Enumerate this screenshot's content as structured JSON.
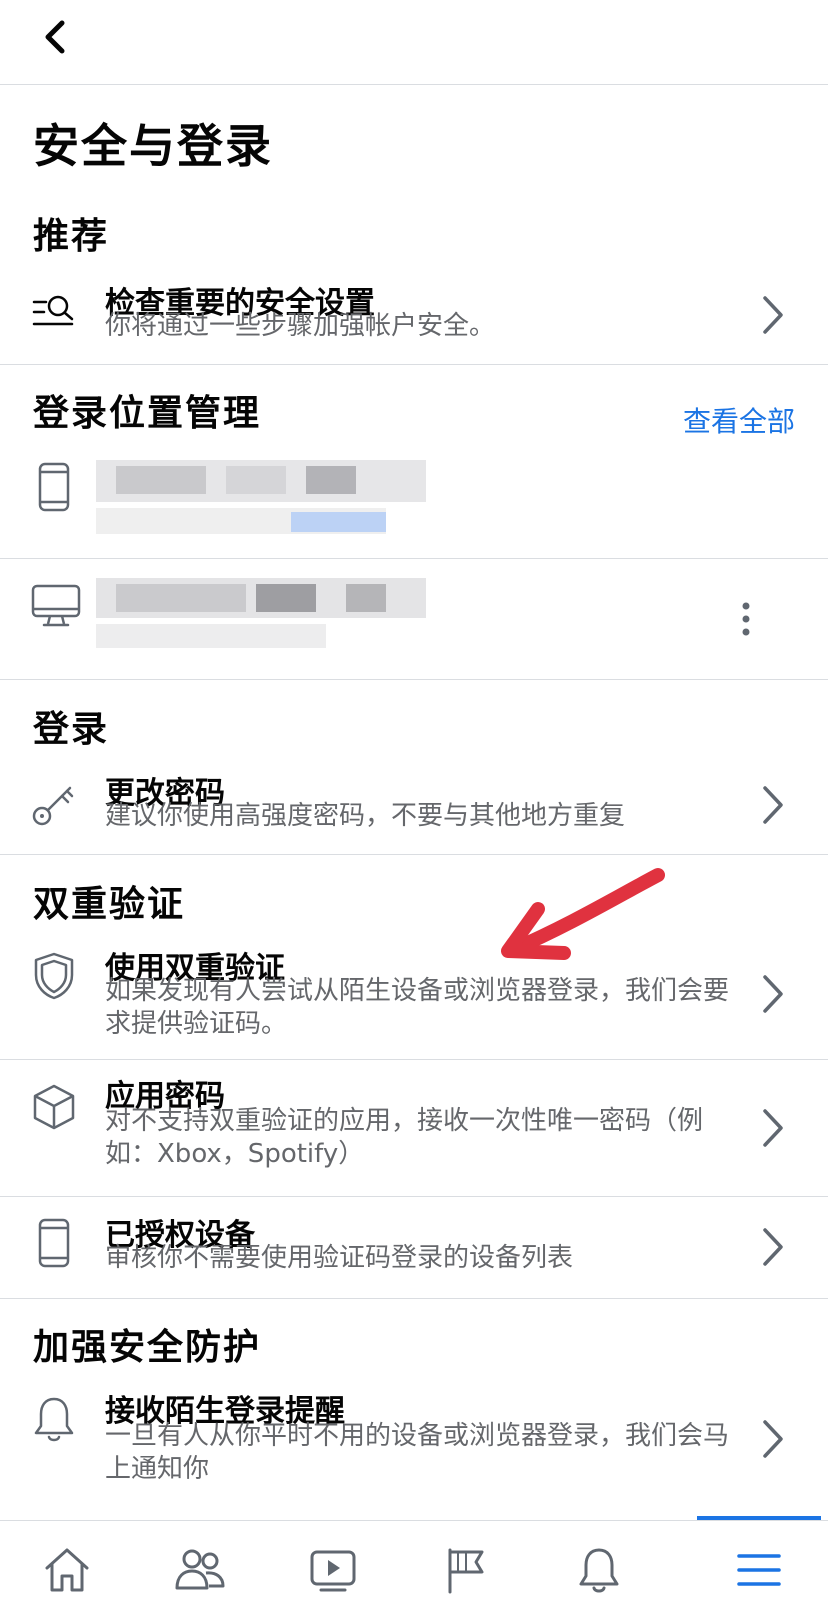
{
  "header": {
    "back_icon": "chevron-left-icon"
  },
  "page_title": "安全与登录",
  "sections": {
    "recommended": {
      "heading": "推荐",
      "item": {
        "title": "检查重要的安全设置",
        "desc": "你将通过一些步骤加强帐户安全。",
        "icon": "search-list-icon"
      }
    },
    "login_locations": {
      "heading": "登录位置管理",
      "view_all": "查看全部",
      "devices": [
        {
          "icon": "phone-icon",
          "name": "",
          "detail": ""
        },
        {
          "icon": "desktop-icon",
          "name": "",
          "detail": ""
        }
      ]
    },
    "login": {
      "heading": "登录",
      "item": {
        "title": "更改密码",
        "desc": "建议你使用高强度密码，不要与其他地方重复",
        "icon": "key-icon"
      }
    },
    "two_factor": {
      "heading": "双重验证",
      "items": [
        {
          "title": "使用双重验证",
          "desc": "如果发现有人尝试从陌生设备或浏览器登录，我们会要求提供验证码。",
          "icon": "shield-icon"
        },
        {
          "title": "应用密码",
          "desc": "对不支持双重验证的应用，接收一次性唯一密码（例如：Xbox，Spotify）",
          "icon": "cube-icon"
        },
        {
          "title": "已授权设备",
          "desc": "审核你不需要使用验证码登录的设备列表",
          "icon": "phone-icon"
        }
      ]
    },
    "extra_security": {
      "heading": "加强安全防护",
      "item": {
        "title": "接收陌生登录提醒",
        "desc": "一旦有人从你平时不用的设备或浏览器登录，我们会马上通知你",
        "icon": "bell-icon"
      }
    }
  },
  "tabbar": {
    "tabs": [
      {
        "icon": "home-icon"
      },
      {
        "icon": "friends-icon"
      },
      {
        "icon": "video-icon"
      },
      {
        "icon": "flag-icon"
      },
      {
        "icon": "bell-icon"
      },
      {
        "icon": "menu-icon",
        "active": true
      }
    ]
  },
  "colors": {
    "accent": "#1b74e4",
    "secondary_text": "#65676b",
    "annotation_arrow": "#e0323f"
  }
}
